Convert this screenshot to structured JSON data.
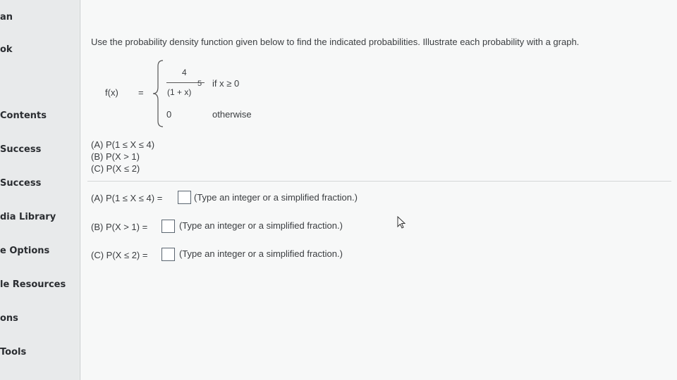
{
  "sidebar": {
    "items": [
      {
        "label": "an"
      },
      {
        "label": "ok"
      },
      {
        "label": "Contents"
      },
      {
        "label": "Success"
      },
      {
        "label": "Success"
      },
      {
        "label": "dia Library"
      },
      {
        "label": "e Options"
      },
      {
        "label": "le Resources"
      },
      {
        "label": "ons"
      },
      {
        "label": "Tools"
      }
    ]
  },
  "question": {
    "instruction": "Use the probability density function given below to find the indicated probabilities. Illustrate each probability with a graph.",
    "function": {
      "lhs": "f(x)",
      "equals": "=",
      "numerator": "4",
      "denominator": "(1 + x)",
      "exponent": "5",
      "condition1": "if x ≥ 0",
      "value2": "0",
      "condition2": "otherwise"
    },
    "parts": [
      "(A) P(1 ≤ X ≤ 4)",
      "(B) P(X > 1)",
      "(C) P(X ≤ 2)"
    ]
  },
  "answers": [
    {
      "label": "(A) P(1 ≤ X ≤ 4) =",
      "hint": "(Type an integer or a simplified fraction.)",
      "value": ""
    },
    {
      "label": "(B) P(X > 1) =",
      "hint": "(Type an integer or a simplified fraction.)",
      "value": ""
    },
    {
      "label": "(C) P(X ≤ 2) =",
      "hint": "(Type an integer or a simplified fraction.)",
      "value": ""
    }
  ]
}
